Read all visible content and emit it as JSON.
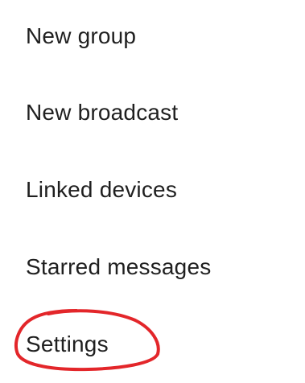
{
  "menu": {
    "items": [
      {
        "label": "New group"
      },
      {
        "label": "New broadcast"
      },
      {
        "label": "Linked devices"
      },
      {
        "label": "Starred messages"
      },
      {
        "label": "Settings"
      }
    ]
  },
  "annotation": {
    "color": "#e3262a",
    "target": "Settings"
  }
}
